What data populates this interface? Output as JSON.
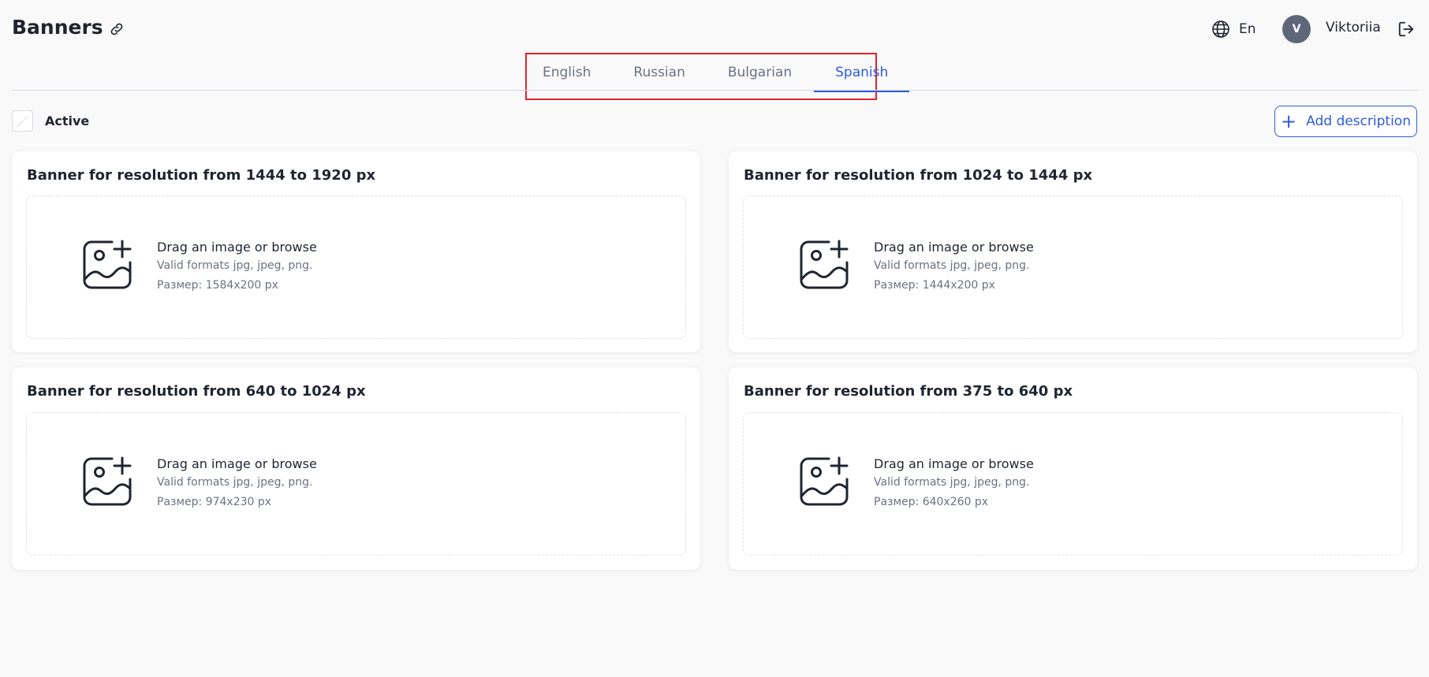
{
  "header": {
    "title": "Banners",
    "language_label": "En",
    "avatar_initial": "V",
    "username": "Viktoriia"
  },
  "tabs": [
    {
      "label": "English",
      "active": false
    },
    {
      "label": "Russian",
      "active": false
    },
    {
      "label": "Bulgarian",
      "active": false
    },
    {
      "label": "Spanish",
      "active": true
    }
  ],
  "toolbar": {
    "active_label": "Active",
    "add_description_label": "Add description"
  },
  "cards": [
    {
      "title": "Banner for resolution from 1444 to 1920 px",
      "drop_text": "Drag an image or browse",
      "formats_text": "Valid formats jpg, jpeg, png.",
      "size_text": "Размер: 1584x200 px"
    },
    {
      "title": "Banner for resolution from 1024 to 1444 px",
      "drop_text": "Drag an image or browse",
      "formats_text": "Valid formats jpg, jpeg, png.",
      "size_text": "Размер: 1444x200 px"
    },
    {
      "title": "Banner for resolution from 640 to 1024 px",
      "drop_text": "Drag an image or browse",
      "formats_text": "Valid formats jpg, jpeg, png.",
      "size_text": "Размер: 974x230 px"
    },
    {
      "title": "Banner for resolution from 375 to 640 px",
      "drop_text": "Drag an image or browse",
      "formats_text": "Valid formats jpg, jpeg, png.",
      "size_text": "Размер: 640x260 px"
    }
  ],
  "colors": {
    "accent": "#2f5bdb",
    "highlight_border": "#e0232d",
    "avatar_bg": "#5d6779"
  },
  "icons": {
    "title_link": "link-icon",
    "language": "globe-icon",
    "logout": "logout-icon",
    "add": "plus-icon",
    "upload": "image-add-icon"
  }
}
